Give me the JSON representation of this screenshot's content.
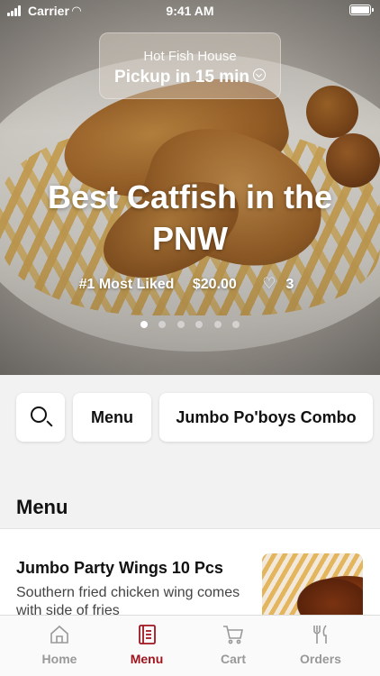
{
  "status_bar": {
    "carrier": "Carrier",
    "time": "9:41 AM"
  },
  "pickup": {
    "store_name": "Hot Fish House",
    "eta": "Pickup in 15 min"
  },
  "hero": {
    "title": "Best Catfish in the PNW",
    "badge": "#1 Most Liked",
    "price": "$20.00",
    "likes": "3",
    "carousel_count": 6,
    "carousel_active": 1
  },
  "chips": {
    "menu_label": "Menu",
    "combo_label": "Jumbo Po'boys Combo"
  },
  "section": {
    "title": "Menu"
  },
  "menu_items": [
    {
      "name": "Jumbo Party Wings 10 Pcs",
      "description": "Southern fried chicken wing comes with side of fries"
    }
  ],
  "tabs": [
    {
      "label": "Home",
      "icon": "home-icon"
    },
    {
      "label": "Menu",
      "icon": "menu-book-icon"
    },
    {
      "label": "Cart",
      "icon": "cart-icon"
    },
    {
      "label": "Orders",
      "icon": "fork-knife-icon"
    }
  ],
  "colors": {
    "accent": "#a0141e",
    "inactive_tab": "#999999"
  }
}
